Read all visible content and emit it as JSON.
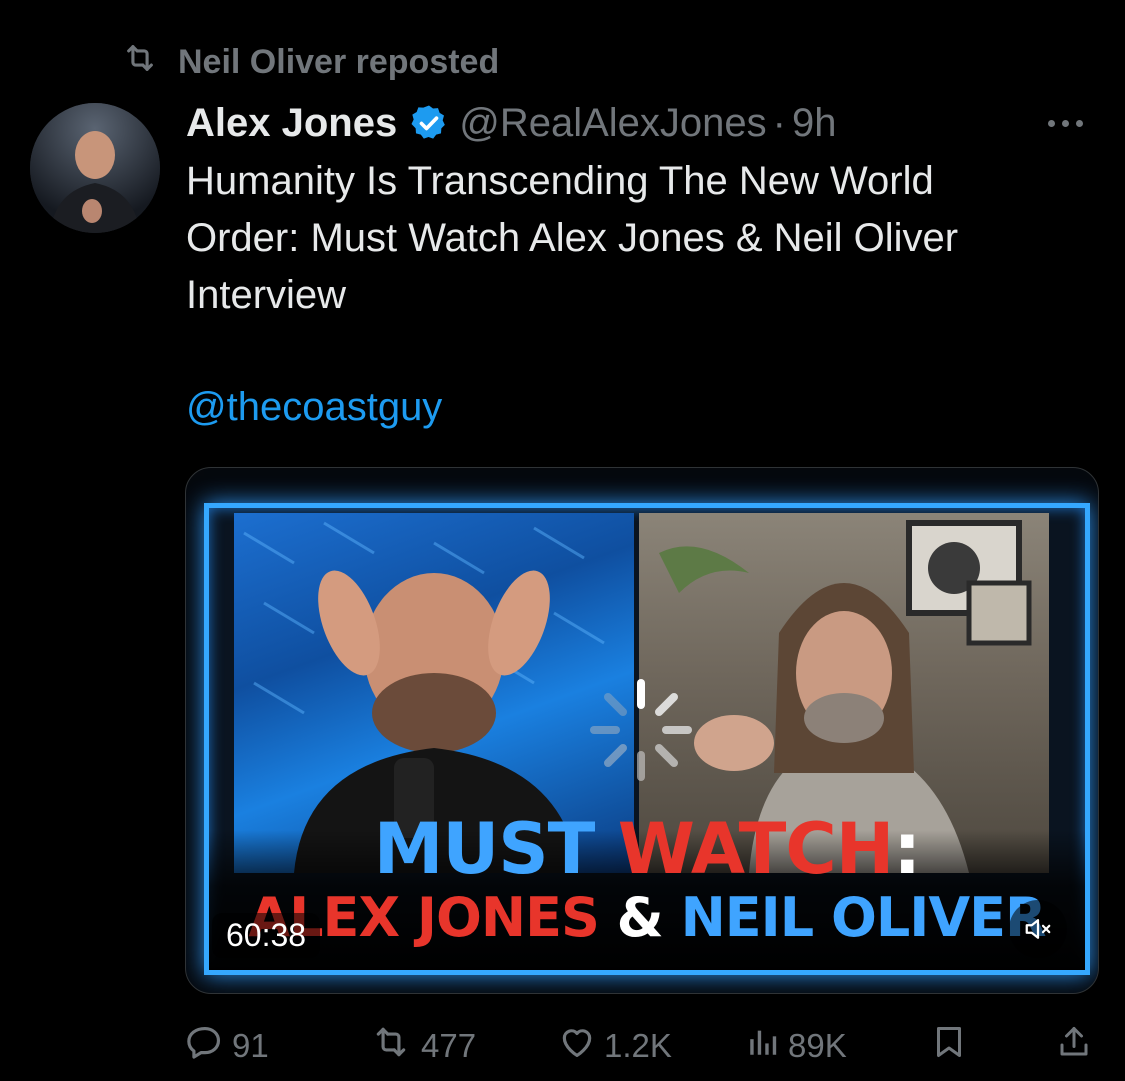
{
  "repost": {
    "label": "Neil Oliver reposted"
  },
  "author": {
    "name": "Alex Jones",
    "handle": "@RealAlexJones",
    "separator": "·",
    "time": "9h"
  },
  "tweet": {
    "text": "Humanity Is Transcending The New World\nOrder: Must Watch Alex Jones & Neil Oliver\nInterview",
    "mention": "@thecoastguy"
  },
  "media": {
    "title_line1": {
      "part1": "MUST ",
      "part2": "WATCH",
      "part3": ":"
    },
    "title_line2": {
      "part1": "ALEX JONES ",
      "part2": "& ",
      "part3": "NEIL OLIVER"
    },
    "duration": "60:38",
    "mute_icon": "speaker-muted-icon",
    "loading_icon": "spinner-icon"
  },
  "actions": {
    "replies": "91",
    "reposts": "477",
    "likes": "1.2K",
    "views": "89K"
  },
  "colors": {
    "background": "#000000",
    "primary_text": "#e7e9ea",
    "secondary_text": "#71767b",
    "link": "#1d9bf0",
    "verified": "#1d9bf0"
  }
}
